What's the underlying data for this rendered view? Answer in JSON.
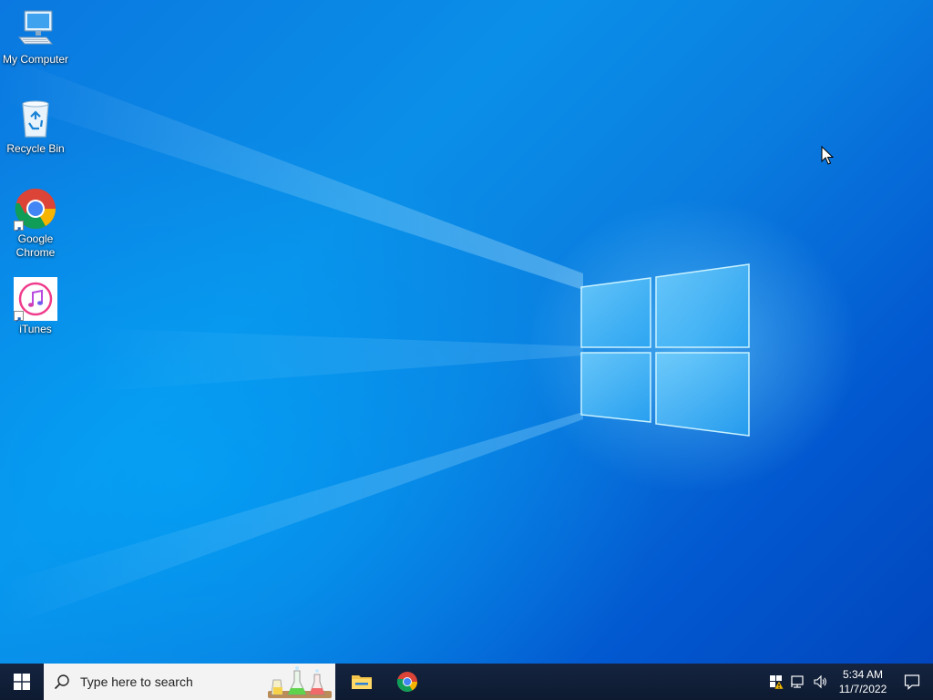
{
  "desktop": {
    "icons": [
      {
        "label": "My Computer",
        "icon": "computer-icon"
      },
      {
        "label": "Recycle Bin",
        "icon": "recycle-bin-icon"
      },
      {
        "label": "Google Chrome",
        "icon": "chrome-icon",
        "shortcut": true
      },
      {
        "label": "iTunes",
        "icon": "itunes-icon",
        "shortcut": true
      }
    ]
  },
  "taskbar": {
    "search_placeholder": "Type here to search",
    "pinned": [
      {
        "name": "File Explorer",
        "icon": "folder-icon"
      },
      {
        "name": "Google Chrome",
        "icon": "chrome-icon"
      }
    ],
    "tray": {
      "icons": [
        "security-alert-icon",
        "network-icon",
        "volume-icon"
      ],
      "time": "5:34 AM",
      "date": "11/7/2022"
    }
  },
  "colors": {
    "taskbar": "#0f1c33",
    "wallpaper_accent": "#0a78e0",
    "search_bg": "#f3f3f3"
  }
}
